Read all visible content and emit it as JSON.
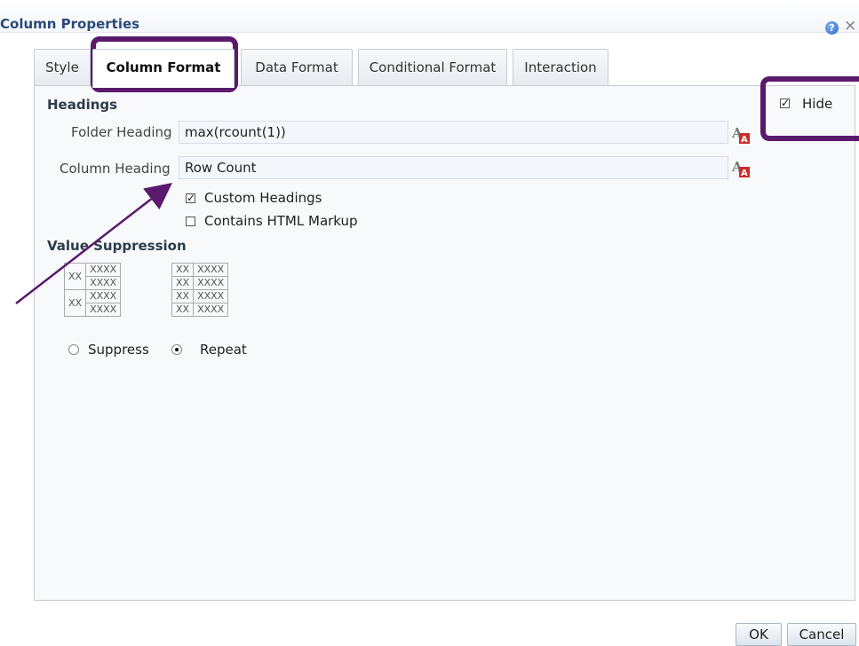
{
  "dialog": {
    "title": "Column Properties",
    "help_icon": "help-icon",
    "close_icon": "close-icon",
    "close_glyph": "×"
  },
  "tabs": [
    {
      "label": "Style",
      "active": false
    },
    {
      "label": "Column Format",
      "active": true
    },
    {
      "label": "Data Format",
      "active": false
    },
    {
      "label": "Conditional Format",
      "active": false
    },
    {
      "label": "Interaction",
      "active": false
    }
  ],
  "headings": {
    "section_title": "Headings",
    "folder_heading_label": "Folder Heading",
    "folder_heading_value": "max(rcount(1))",
    "column_heading_label": "Column Heading",
    "column_heading_value": "Row Count",
    "custom_headings_label": "Custom Headings",
    "custom_headings_checked": true,
    "html_markup_label": "Contains HTML Markup",
    "html_markup_checked": false,
    "hide_label": "Hide",
    "hide_checked": true
  },
  "value_suppression": {
    "section_title": "Value Suppression",
    "left_example": [
      [
        "XX",
        "XXXX"
      ],
      [
        "",
        "XXXX"
      ],
      [
        "XX",
        "XXXX"
      ],
      [
        "",
        "XXXX"
      ]
    ],
    "right_example": [
      [
        "XX",
        "XXXX"
      ],
      [
        "XX",
        "XXXX"
      ],
      [
        "XX",
        "XXXX"
      ],
      [
        "XX",
        "XXXX"
      ]
    ],
    "suppress_label": "Suppress",
    "repeat_label": "Repeat",
    "selected": "Repeat"
  },
  "buttons": {
    "ok": "OK",
    "cancel": "Cancel"
  },
  "annotation": {
    "highlight_color": "#5a1a6b"
  },
  "colors": {
    "title": "#2b4a7a",
    "panel_bg": "#f7f9fb",
    "field_bg": "#f3f7fc"
  }
}
